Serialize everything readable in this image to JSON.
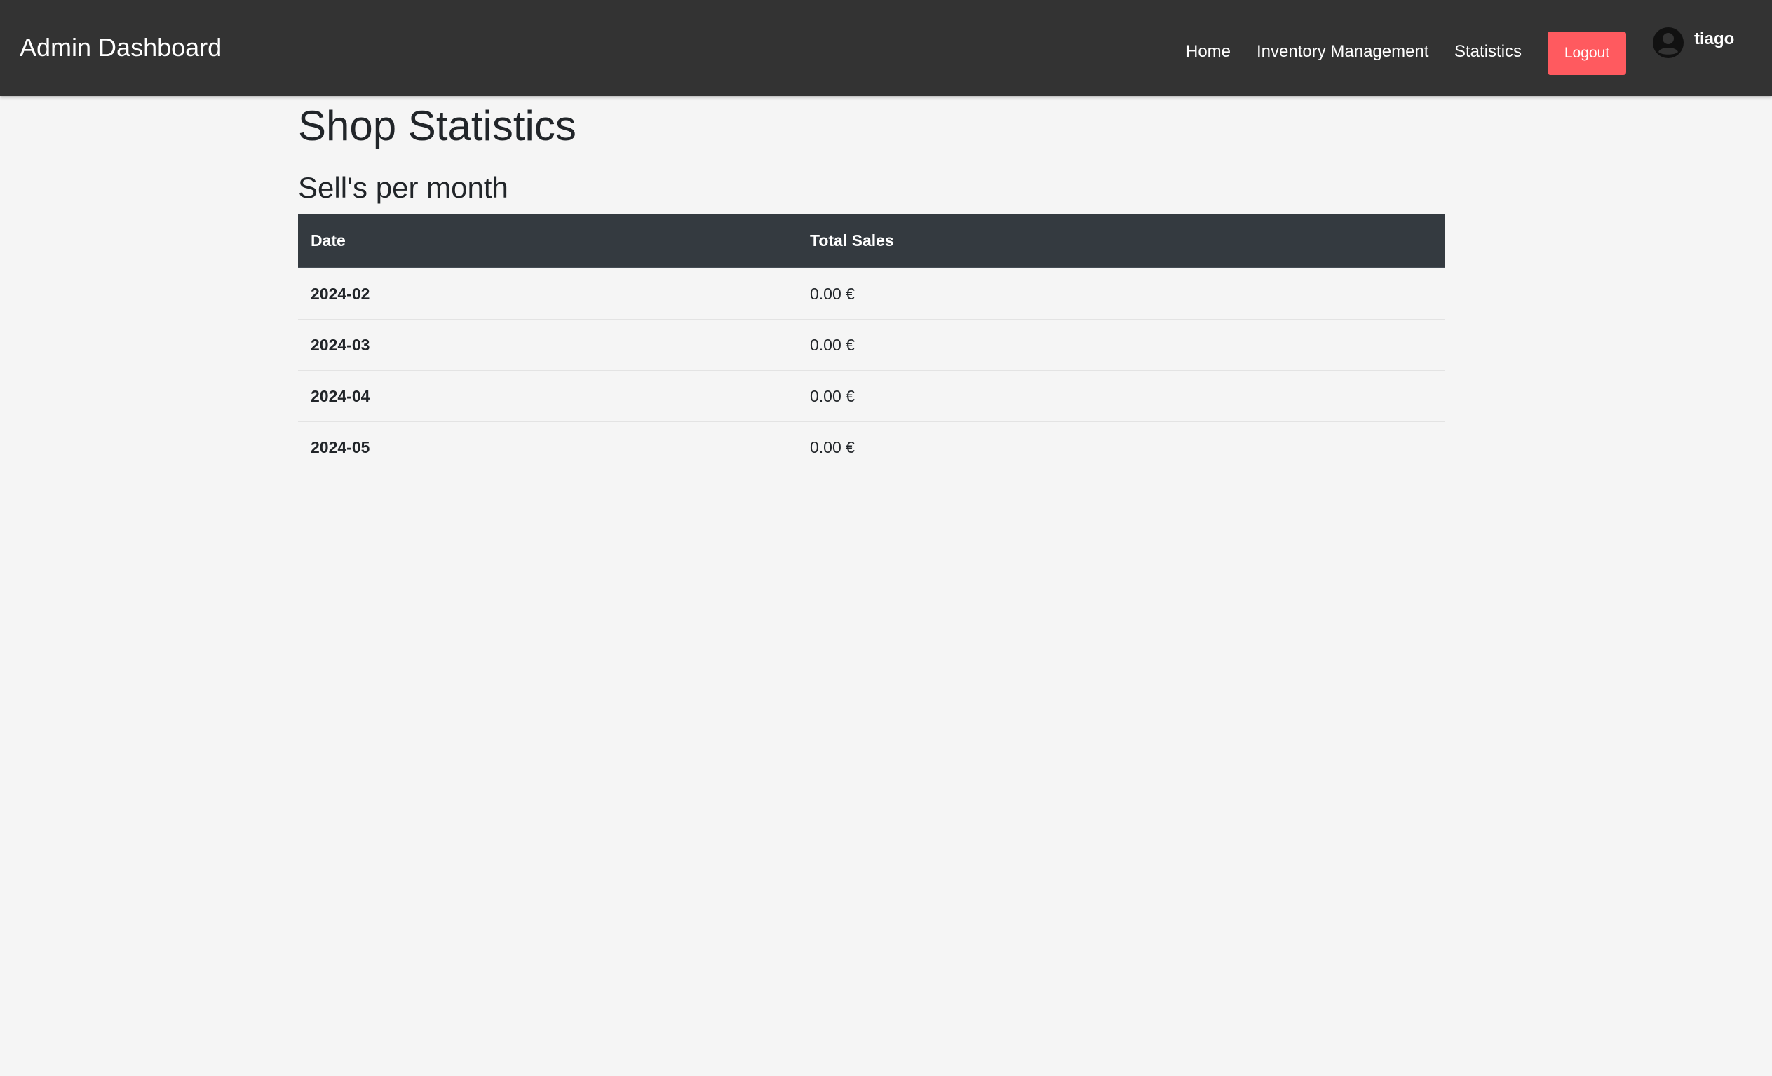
{
  "navbar": {
    "brand": "Admin Dashboard",
    "links": [
      "Home",
      "Inventory Management",
      "Statistics"
    ],
    "logout_label": "Logout",
    "username": "tiago",
    "avatar_icon": "user-circle-icon",
    "logout_color": "#ff5a5f",
    "background_color": "#333333"
  },
  "main": {
    "title": "Shop Statistics",
    "section_title": "Sell's per month",
    "table": {
      "headers": [
        "Date",
        "Total Sales"
      ],
      "rows": [
        {
          "date": "2024-02",
          "total": "0.00 €"
        },
        {
          "date": "2024-03",
          "total": "0.00 €"
        },
        {
          "date": "2024-04",
          "total": "0.00 €"
        },
        {
          "date": "2024-05",
          "total": "0.00 €"
        }
      ]
    }
  }
}
